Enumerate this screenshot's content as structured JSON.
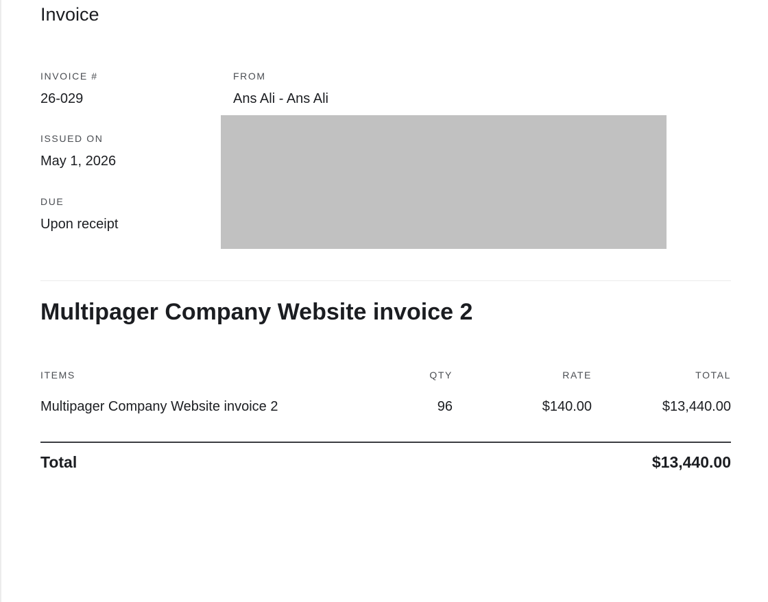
{
  "document": {
    "title": "Invoice"
  },
  "meta": {
    "invoice_number_label": "INVOICE #",
    "invoice_number": "26-029",
    "issued_label": "ISSUED ON",
    "issued_date": "May 1, 2026",
    "due_label": "DUE",
    "due_value": "Upon receipt"
  },
  "from": {
    "label": "FROM",
    "name": "Ans Ali - Ans Ali"
  },
  "project": {
    "title": "Multipager Company Website invoice 2"
  },
  "table": {
    "headers": {
      "items": "ITEMS",
      "qty": "QTY",
      "rate": "RATE",
      "total": "TOTAL"
    },
    "rows": [
      {
        "item": "Multipager Company Website invoice 2",
        "qty": "96",
        "rate": "$140.00",
        "total": "$13,440.00"
      }
    ]
  },
  "summary": {
    "total_label": "Total",
    "total_amount": "$13,440.00"
  },
  "colors": {
    "text": "#1b1d21",
    "muted_label": "#4a4d52",
    "redaction": "#c1c1c1"
  }
}
